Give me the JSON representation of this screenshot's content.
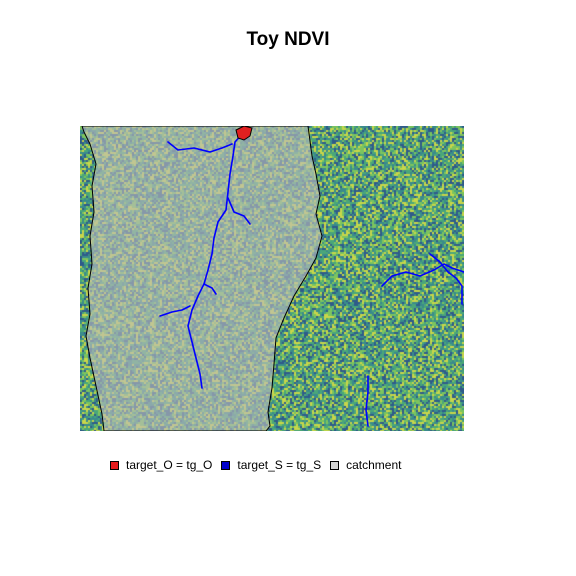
{
  "title": "Toy NDVI",
  "map": {
    "raster_palette": [
      "#2f5b8a",
      "#3a8b8c",
      "#4aa67a",
      "#7cc45e",
      "#c8d64a"
    ],
    "catchment_fill": "#bcbcbc",
    "catchment_outline": "#000000",
    "river_color": "#0000ff",
    "outlet_color": "#e02020"
  },
  "legend": {
    "items": [
      {
        "label": "target_O = tg_O",
        "color": "#e41a1c"
      },
      {
        "label": "target_S = tg_S",
        "color": "#0000cd"
      },
      {
        "label": "catchment",
        "color": "#d3d3d3"
      }
    ]
  }
}
